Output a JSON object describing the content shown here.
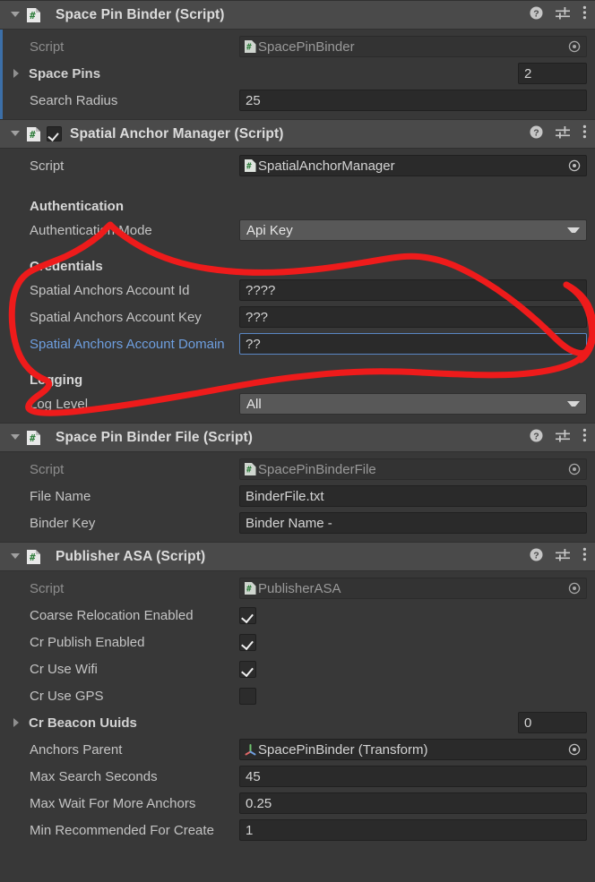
{
  "accent": {
    "selection_strip": "#3c6fa8",
    "header_bg": "#4a4a4a",
    "panel_bg": "#383838",
    "field_bg": "#2a2a2a",
    "dropdown_bg": "#585858",
    "link_text": "#6e9fe0",
    "focus_border": "#5a87c4",
    "annotation_ink": "#ee1b1b"
  },
  "icons": {
    "foldout_open": "chevron-down-icon",
    "foldout_closed": "chevron-right-icon",
    "script": "cs-script-icon",
    "help": "help-icon",
    "preset": "preset-sliders-icon",
    "menu": "kebab-menu-icon",
    "picker": "object-picker-icon",
    "transform": "transform-axes-icon"
  },
  "components": [
    {
      "title": "Space Pin Binder (Script)",
      "expanded": true,
      "has_enable_toggle": false,
      "enabled": false,
      "selected": true,
      "rows": [
        {
          "kind": "object",
          "label": "Script",
          "value": "SpacePinBinder",
          "disabled": true,
          "icon": "cs-script-icon"
        },
        {
          "kind": "array",
          "label": "Space Pins",
          "value": "2",
          "bold": true,
          "foldout": "closed"
        },
        {
          "kind": "text",
          "label": "Search Radius",
          "value": "25"
        }
      ]
    },
    {
      "title": "Spatial Anchor Manager (Script)",
      "expanded": true,
      "has_enable_toggle": true,
      "enabled": true,
      "selected": false,
      "rows": [
        {
          "kind": "object",
          "label": "Script",
          "value": "SpatialAnchorManager",
          "disabled": true,
          "icon": "cs-script-icon"
        },
        {
          "kind": "spacer"
        },
        {
          "kind": "section",
          "label": "Authentication"
        },
        {
          "kind": "dropdown",
          "label": "Authentication Mode",
          "value": "Api Key"
        },
        {
          "kind": "spacer"
        },
        {
          "kind": "section",
          "label": "Credentials"
        },
        {
          "kind": "text",
          "label": "Spatial Anchors Account Id",
          "value": "????"
        },
        {
          "kind": "text",
          "label": "Spatial Anchors Account Key",
          "value": "???"
        },
        {
          "kind": "text",
          "label": "Spatial Anchors Account Domain",
          "value": "??",
          "link": true,
          "focused": true
        },
        {
          "kind": "spacer"
        },
        {
          "kind": "section",
          "label": "Logging"
        },
        {
          "kind": "dropdown",
          "label": "Log Level",
          "value": "All"
        }
      ]
    },
    {
      "title": "Space Pin Binder File (Script)",
      "expanded": true,
      "has_enable_toggle": false,
      "enabled": false,
      "selected": false,
      "rows": [
        {
          "kind": "object",
          "label": "Script",
          "value": "SpacePinBinderFile",
          "disabled": true,
          "icon": "cs-script-icon"
        },
        {
          "kind": "text",
          "label": "File Name",
          "value": "BinderFile.txt"
        },
        {
          "kind": "text",
          "label": "Binder Key",
          "value": "Binder Name -"
        }
      ]
    },
    {
      "title": "Publisher ASA (Script)",
      "expanded": true,
      "has_enable_toggle": false,
      "enabled": false,
      "selected": false,
      "rows": [
        {
          "kind": "object",
          "label": "Script",
          "value": "PublisherASA",
          "disabled": true,
          "icon": "cs-script-icon"
        },
        {
          "kind": "checkbox",
          "label": "Coarse Relocation Enabled",
          "checked": true
        },
        {
          "kind": "checkbox",
          "label": "Cr Publish Enabled",
          "checked": true
        },
        {
          "kind": "checkbox",
          "label": "Cr Use Wifi",
          "checked": true
        },
        {
          "kind": "checkbox",
          "label": "Cr Use GPS",
          "checked": false
        },
        {
          "kind": "array",
          "label": "Cr Beacon Uuids",
          "value": "0",
          "bold": true,
          "foldout": "closed"
        },
        {
          "kind": "object",
          "label": "Anchors Parent",
          "value": "SpacePinBinder (Transform)",
          "disabled": false,
          "icon": "transform-axes-icon"
        },
        {
          "kind": "text",
          "label": "Max Search Seconds",
          "value": "45"
        },
        {
          "kind": "text",
          "label": "Max Wait For More Anchors",
          "value": "0.25"
        },
        {
          "kind": "text",
          "label": "Min Recommended For Create",
          "value": "1"
        }
      ]
    }
  ],
  "annotation": {
    "present": true,
    "shape": "freehand-ellipse",
    "encircles": "Credentials group of Spatial Anchor Manager"
  }
}
